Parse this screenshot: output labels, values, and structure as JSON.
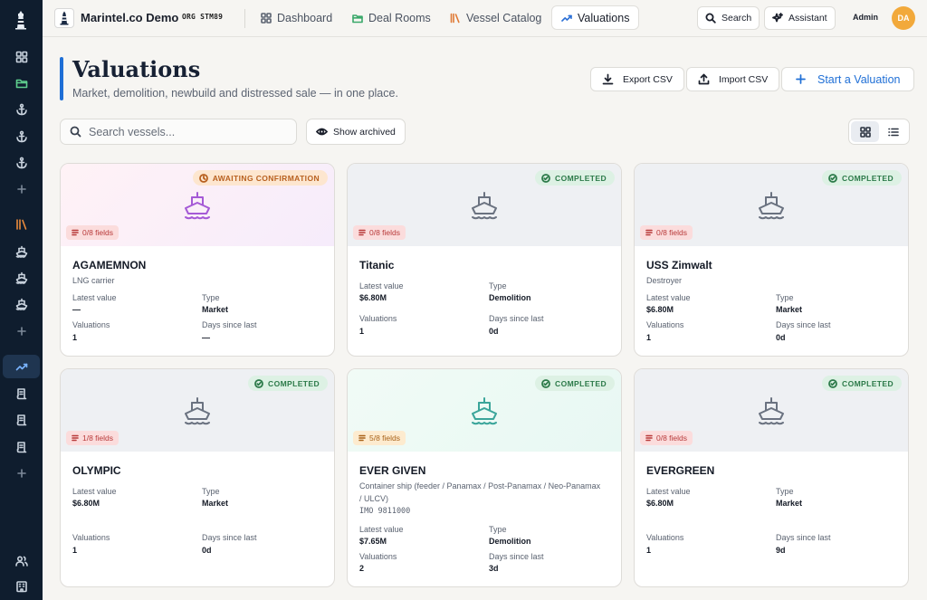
{
  "app": {
    "brand": "Marintel.co Demo",
    "org": "ORG STM89",
    "user_role": "Admin",
    "avatar_initials": "DA"
  },
  "colors": {
    "accent": "#1f6fd6",
    "sidebar": "#0f1d2e",
    "completed": "#2c7a49",
    "awaiting": "#b8601f",
    "avatar": "#f2a93b"
  },
  "nav": {
    "dashboard": "Dashboard",
    "deal_rooms": "Deal Rooms",
    "vessel_catalog": "Vessel Catalog",
    "valuations": "Valuations"
  },
  "topbar": {
    "search_label": "Search",
    "assistant_label": "Assistant"
  },
  "sidebar": {
    "icons": [
      "grid-icon",
      "folder-icon",
      "anchor-icon",
      "anchor-icon",
      "anchor-icon",
      "plus-icon",
      "library-icon",
      "ship-icon",
      "ship-icon",
      "ship-icon",
      "plus-icon",
      "trending-icon",
      "document-icon",
      "document-icon",
      "document-icon",
      "plus-icon",
      "users-icon",
      "building-icon"
    ],
    "active": "trending-icon"
  },
  "page": {
    "title": "Valuations",
    "subtitle": "Market, demolition, newbuild and distressed sale — in one place.",
    "export_label": "Export CSV",
    "import_label": "Import CSV",
    "start_label": "Start a Valuation",
    "search_placeholder": "Search vessels...",
    "archived_label": "Show archived"
  },
  "labels": {
    "latest_value": "Latest value",
    "type": "Type",
    "valuations": "Valuations",
    "days_since_last": "Days since last"
  },
  "cards": [
    {
      "name": "AGAMEMNON",
      "vessel_type": "LNG carrier",
      "status": "AWAITING CONFIRMATION",
      "fields": "0/8 fields",
      "latest_value": "—",
      "type": "Market",
      "valuations": "1",
      "days_since_last": "—"
    },
    {
      "name": "Titanic",
      "vessel_type": "",
      "status": "COMPLETED",
      "fields": "0/8 fields",
      "latest_value": "$6.80M",
      "type": "Demolition",
      "valuations": "1",
      "days_since_last": "0d"
    },
    {
      "name": "USS Zimwalt",
      "vessel_type": "Destroyer",
      "status": "COMPLETED",
      "fields": "0/8 fields",
      "latest_value": "$6.80M",
      "type": "Market",
      "valuations": "1",
      "days_since_last": "0d"
    },
    {
      "name": "OLYMPIC",
      "vessel_type": "",
      "status": "COMPLETED",
      "fields": "1/8 fields",
      "latest_value": "$6.80M",
      "type": "Market",
      "valuations": "1",
      "days_since_last": "0d"
    },
    {
      "name": "EVER GIVEN",
      "vessel_type": "Container ship (feeder / Panamax / Post-Panamax / Neo-Panamax / ULCV)",
      "imo": "IMO 9811000",
      "status": "COMPLETED",
      "fields": "5/8 fields",
      "latest_value": "$7.65M",
      "type": "Demolition",
      "valuations": "2",
      "days_since_last": "3d"
    },
    {
      "name": "EVERGREEN",
      "vessel_type": "",
      "status": "COMPLETED",
      "fields": "0/8 fields",
      "latest_value": "$6.80M",
      "type": "Market",
      "valuations": "1",
      "days_since_last": "9d"
    }
  ]
}
